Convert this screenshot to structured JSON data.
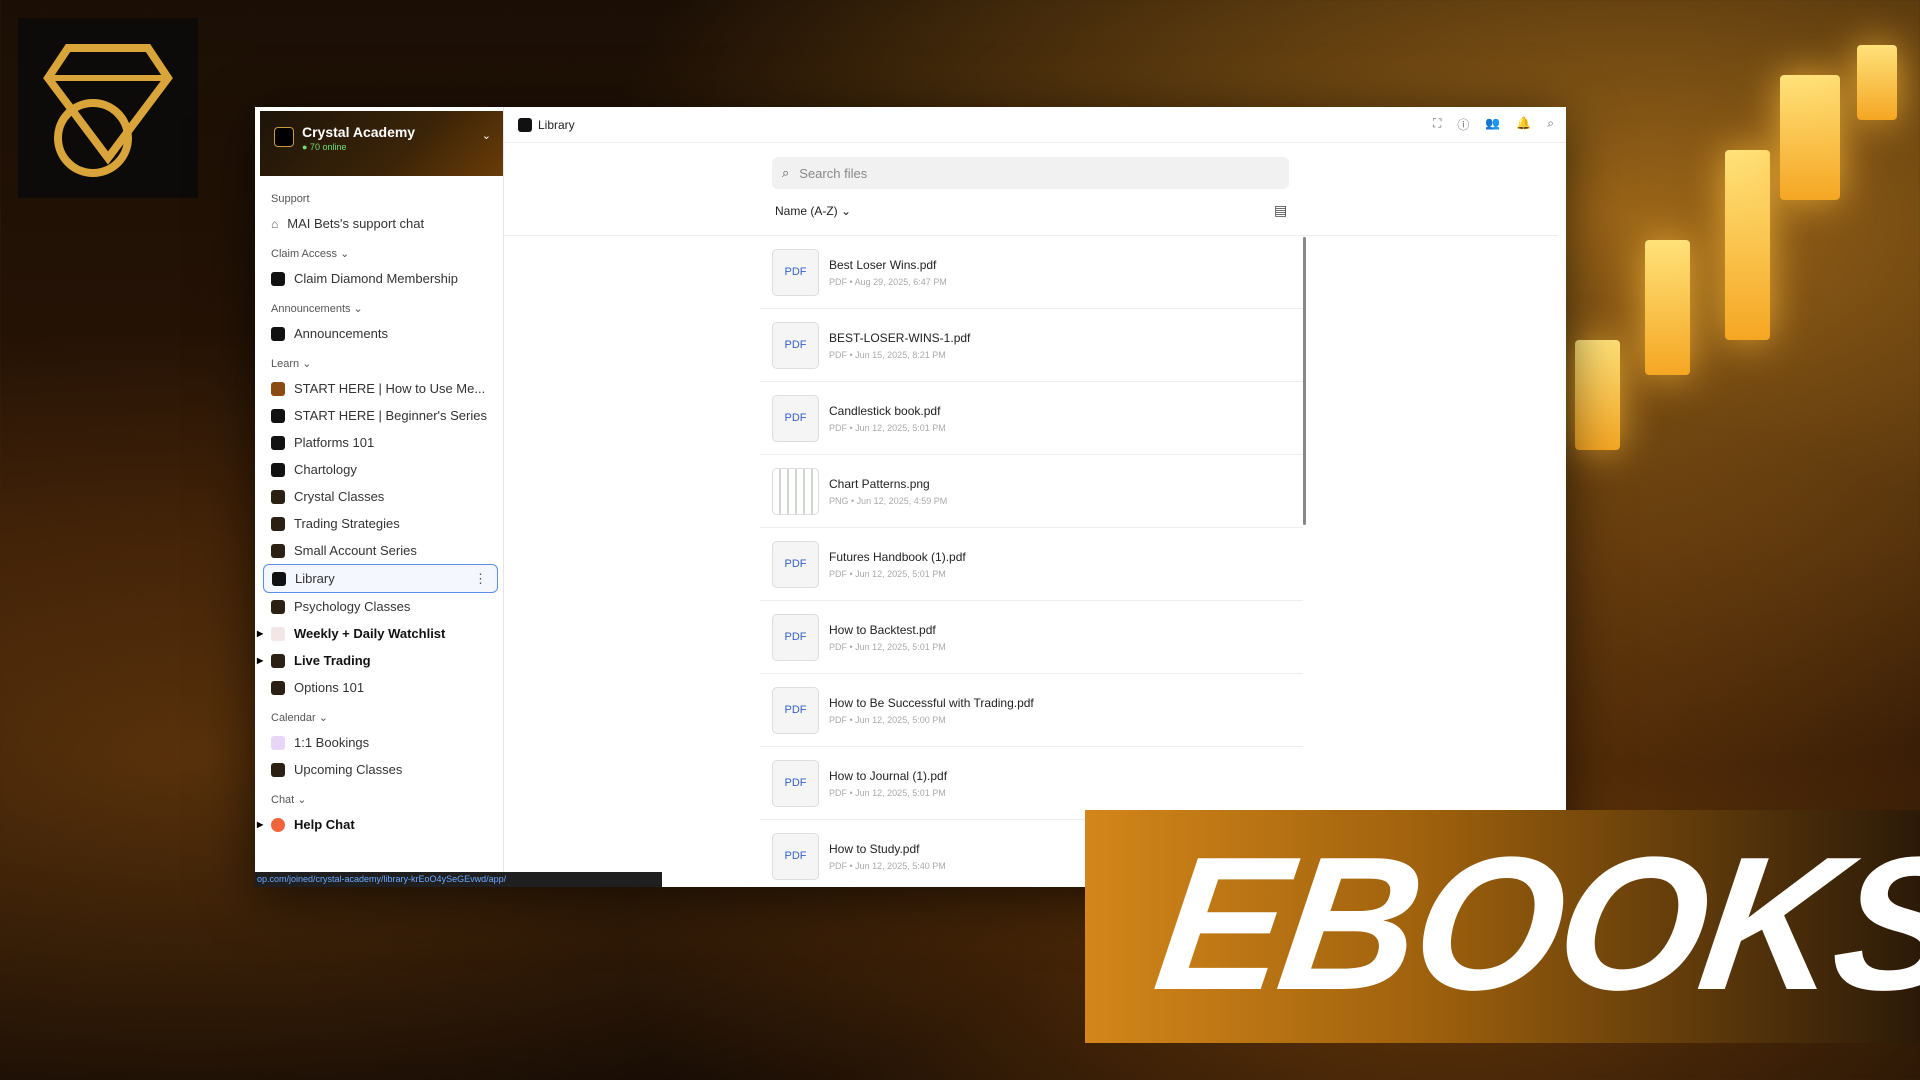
{
  "sidebar": {
    "server_name": "Crystal Academy",
    "online": "● 70 online",
    "sections": [
      {
        "title": "Support",
        "items": [
          {
            "label": "MAI Bets's support chat"
          }
        ]
      },
      {
        "title": "Claim Access ⌄",
        "items": [
          {
            "label": "Claim Diamond Membership"
          }
        ]
      },
      {
        "title": "Announcements ⌄",
        "items": [
          {
            "label": "Announcements"
          }
        ]
      },
      {
        "title": "Learn ⌄",
        "items": [
          {
            "label": "START HERE | How to Use Me..."
          },
          {
            "label": "START HERE | Beginner's Series"
          },
          {
            "label": "Platforms 101"
          },
          {
            "label": "Chartology"
          },
          {
            "label": "Crystal Classes"
          },
          {
            "label": "Trading Strategies"
          },
          {
            "label": "Small Account Series"
          },
          {
            "label": "Library"
          },
          {
            "label": "Psychology Classes"
          },
          {
            "label": "Weekly + Daily Watchlist"
          },
          {
            "label": "Live Trading"
          },
          {
            "label": "Options 101"
          }
        ]
      },
      {
        "title": "Calendar ⌄",
        "items": [
          {
            "label": "1:1 Bookings"
          },
          {
            "label": "Upcoming Classes"
          }
        ]
      },
      {
        "title": "Chat ⌄",
        "items": [
          {
            "label": "Help Chat"
          }
        ]
      }
    ]
  },
  "statusbar": {
    "url": "op.com/joined/crystal-academy/library-krEoO4ySeGEvwd/app/"
  },
  "topbar": {
    "title": "Library"
  },
  "search": {
    "placeholder": "Search files"
  },
  "sort": {
    "label": "Name (A-Z) ⌄"
  },
  "files": [
    {
      "thumb": "PDF",
      "name": "Best Loser Wins.pdf",
      "meta": "PDF • Aug 29, 2025, 6:47 PM"
    },
    {
      "thumb": "PDF",
      "name": "BEST-LOSER-WINS-1.pdf",
      "meta": "PDF • Jun 15, 2025, 8:21 PM"
    },
    {
      "thumb": "PDF",
      "name": "Candlestick book.pdf",
      "meta": "PDF • Jun 12, 2025, 5:01 PM"
    },
    {
      "thumb": "",
      "name": "Chart Patterns.png",
      "meta": "PNG • Jun 12, 2025, 4:59 PM"
    },
    {
      "thumb": "PDF",
      "name": "Futures Handbook (1).pdf",
      "meta": "PDF • Jun 12, 2025, 5:01 PM"
    },
    {
      "thumb": "PDF",
      "name": "How to Backtest.pdf",
      "meta": "PDF • Jun 12, 2025, 5:01 PM"
    },
    {
      "thumb": "PDF",
      "name": "How to Be Successful with Trading.pdf",
      "meta": "PDF • Jun 12, 2025, 5:00 PM"
    },
    {
      "thumb": "PDF",
      "name": "How to Journal (1).pdf",
      "meta": "PDF • Jun 12, 2025, 5:01 PM"
    },
    {
      "thumb": "PDF",
      "name": "How to Study.pdf",
      "meta": "PDF • Jun 12, 2025, 5:40 PM"
    }
  ],
  "banner": {
    "text": "EBOOKS"
  }
}
